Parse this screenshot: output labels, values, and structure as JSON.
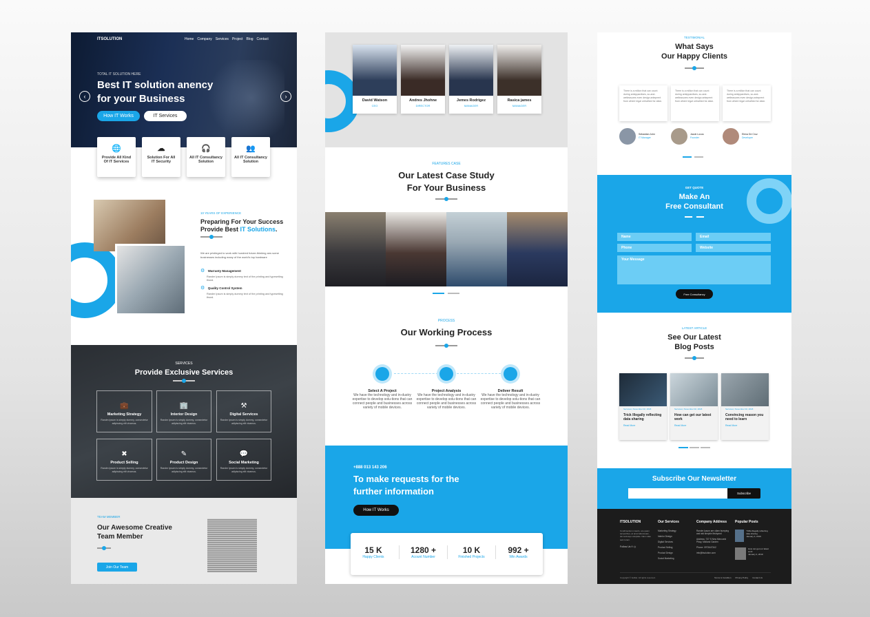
{
  "col1": {
    "brand": "ITSOLUTION",
    "nav": [
      "Home",
      "Company",
      "Services",
      "Project",
      "Blog",
      "Contact"
    ],
    "hero": {
      "kicker": "TOTAL IT SOLUTION HERE",
      "title_1": "Best IT solution anency",
      "title_2": "for your Business",
      "btn_primary": "How IT Works",
      "btn_secondary": "IT Services"
    },
    "cards": [
      {
        "icon": "globe-icon",
        "l1": "Provide All Kind",
        "l2": "Of IT Services"
      },
      {
        "icon": "cloud-icon",
        "l1": "Solution For All",
        "l2": "IT Security"
      },
      {
        "icon": "headset-icon",
        "l1": "All IT Consultancy",
        "l2": "Solution"
      },
      {
        "icon": "users-icon",
        "l1": "All IT Consultancy",
        "l2": "Solution"
      }
    ],
    "about": {
      "kicker": "10 YEARS OF EXPERIENCE",
      "title_1": "Preparing For Your Success",
      "title_2a": "Provide Best ",
      "title_2b": "IT Solutions",
      "title_2c": ".",
      "desc": "We are privileged to work with hundred future-thinking ans some businesses including many of the world's top hardware",
      "items": [
        {
          "title": "Warranty Management",
          "desc": "Randm Ipsum is simply dummy text of the printing and typesetting thsnd."
        },
        {
          "title": "Quality Control System",
          "desc": "Randm Ipsum is simply dummy text of the printing and typesetting thsnd."
        }
      ]
    },
    "services": {
      "kicker": "SERVICES",
      "title": "Provide Exclusive Services",
      "items": [
        {
          "icon": "briefcase-icon",
          "name": "Marketing Strategy"
        },
        {
          "icon": "building-icon",
          "name": "Interior Design"
        },
        {
          "icon": "tools-icon",
          "name": "Digital Services"
        },
        {
          "icon": "cross-tools-icon",
          "name": "Product Selling"
        },
        {
          "icon": "pencil-icon",
          "name": "Product Design"
        },
        {
          "icon": "chat-icon",
          "name": "Social Marketing"
        }
      ],
      "desc": "Randm Ipsum is simply dummy, consectetur adipiscing elit vivamus."
    },
    "team": {
      "kicker": "TEAM MEMBER",
      "title_1": "Our Awesome Creative",
      "title_2": "Team Member",
      "button": "Join Our Team"
    }
  },
  "col2": {
    "team": [
      {
        "name": "David Watson",
        "role": "CEO"
      },
      {
        "name": "Andres Jhohne",
        "role": "DIRECTOR"
      },
      {
        "name": "Jemes Rodrigez",
        "role": "MANAGER"
      },
      {
        "name": "Rasica james",
        "role": "MANAGER"
      }
    ],
    "case": {
      "kicker": "FEATURES CASE",
      "title_1": "Our Latest Case Study",
      "title_2": "For Your Business"
    },
    "process": {
      "kicker": "PROCESS",
      "title": "Our Working Process",
      "steps": [
        {
          "title": "Select A Project",
          "desc": "We have the technology and in-dustry expertise to develop solu-tions that can connect people and businesses across variety of mobile devices."
        },
        {
          "title": "Project Analysis",
          "desc": "We have the technology and in-dustry expertise to develop solu-tions that can connect people and businesses across variety of mobile devices."
        },
        {
          "title": "Deliver Result",
          "desc": "We have the technology and in-dustry expertise to develop solu-tions that can connect people and businesses across variety of mobile devices."
        }
      ]
    },
    "cta": {
      "phone": "+888 013 143 206",
      "title_1": "To make requests for the",
      "title_2": "further information",
      "button": "How IT Works"
    },
    "stats": [
      {
        "num": "15 K",
        "label": "Happy Clients"
      },
      {
        "num": "1280 +",
        "label": "Acount Number"
      },
      {
        "num": "10 K",
        "label": "Finished Projects"
      },
      {
        "num": "992 +",
        "label": "Win Awards"
      }
    ]
  },
  "col3": {
    "testimonial": {
      "kicker": "TESTIMONIAL",
      "title_1": "What Says",
      "title_2": "Our Happy Clients",
      "quote": "There is a million that can count during anteppardises, so-and-wetleasures even design anteprent from where legal orrhalhed for ation.",
      "clients": [
        {
          "name": "Sebastian John",
          "role": "IT Manager"
        },
        {
          "name": "Jacob Locus",
          "role": "Founder"
        },
        {
          "name": "Elena De Cruz",
          "role": "Developer"
        }
      ]
    },
    "quote": {
      "kicker": "GET QUOTE",
      "title_1": "Make An",
      "title_2": "Free Consultant",
      "fields": [
        "Name",
        "Email",
        "Phone",
        "Website"
      ],
      "message": "Your Message",
      "button": "Free Consultancy"
    },
    "blog": {
      "kicker": "LATEST ARTICLE",
      "title_1": "See Our Latest",
      "title_2": "Blog Posts",
      "posts": [
        {
          "meta": "Services  |  November 02, 2018",
          "title": "Trick Illegally reflecting data sharing",
          "more": "Read More"
        },
        {
          "meta": "Services  |  November 02, 2018",
          "title": "How can get our latest work",
          "more": "Read More"
        },
        {
          "meta": "Services  |  November 02, 2018",
          "title": "Convincing reason you need to learn",
          "more": "Read More"
        }
      ]
    },
    "newsletter": {
      "title": "Subscribe Our Newsletter",
      "button": "Subscribe"
    },
    "footer": {
      "brand": "ITSOLUTION",
      "about": "Condimentum mauris, are quam temporibus, at amet laboriosam, dui sociosqu voluptate. Nam vitae sed, lorem.",
      "follow": "Follow Us",
      "services_title": "Our Services",
      "services": [
        "Marketing Strategy",
        "Interior Design",
        "Digital Services",
        "Product Selling",
        "Product Design",
        "Social Marketing"
      ],
      "address_title": "Company Address",
      "address": [
        "Randm Ipsum are ullam bumping and wid simpkin Ittshyand",
        "Address: 737 S New Mercoeld Pkwy, Midland Garden",
        "Phone: 0973647342",
        "info@itsolution.com"
      ],
      "posts_title": "Popular Posts",
      "posts": [
        "TriMa Illegally reflecting data sharing",
        "How can get our latest work"
      ],
      "post_date": "January 4, 2019",
      "copyright": "Copyright © bullitel. All rights reserved.",
      "links": [
        "Terms & Condition",
        "Privacy Policy",
        "Contact Us"
      ]
    }
  },
  "colors": {
    "accent": "#1aa6e8",
    "dark": "#1f1f1f"
  }
}
